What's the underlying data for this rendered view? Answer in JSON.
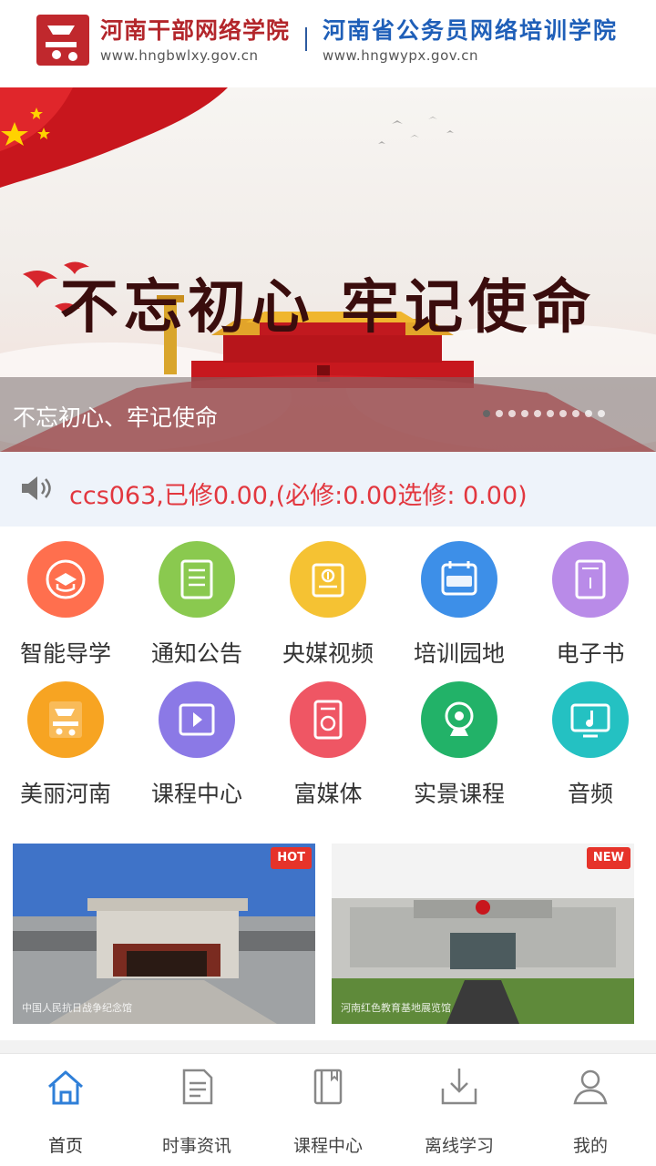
{
  "header": {
    "brand_left_name": "河南干部网络学院",
    "brand_left_url": "www.hngbwlxy.gov.cn",
    "brand_right_name": "河南省公务员网络培训学院",
    "brand_right_url": "www.hngwypx.gov.cn",
    "logo_icon": "red-seal-logo-icon"
  },
  "banner": {
    "title": "不忘初心 牢记使命",
    "caption": "不忘初心、牢记使命",
    "slide_count": 10,
    "active_slide": 1
  },
  "notice": {
    "icon": "speaker-icon",
    "text": "ccs063,已修0.00,(必修:0.00选修: 0.00)",
    "color": "#e2373f"
  },
  "grid": [
    {
      "label": "智能导学",
      "icon": "guide-icon",
      "color": "#ff6f4e"
    },
    {
      "label": "通知公告",
      "icon": "notice-board-icon",
      "color": "#8ac94f"
    },
    {
      "label": "央媒视频",
      "icon": "media-video-icon",
      "color": "#f5c233"
    },
    {
      "label": "培训园地",
      "icon": "class-calendar-icon",
      "color": "#3d8fe8"
    },
    {
      "label": "电子书",
      "icon": "ebook-icon",
      "color": "#b98be8"
    },
    {
      "label": "美丽河南",
      "icon": "henan-seal-icon",
      "color": "#f7a422"
    },
    {
      "label": "课程中心",
      "icon": "video-course-icon",
      "color": "#8b79e6"
    },
    {
      "label": "富媒体",
      "icon": "rich-media-icon",
      "color": "#ef5664"
    },
    {
      "label": "实景课程",
      "icon": "webcam-icon",
      "color": "#22b268"
    },
    {
      "label": "音频",
      "icon": "audio-icon",
      "color": "#24c1c2"
    }
  ],
  "promos": [
    {
      "badge": "HOT",
      "caption": "中国人民抗日战争纪念馆",
      "color": "#e6332a"
    },
    {
      "badge": "NEW",
      "caption": "河南红色教育基地展览馆",
      "color": "#e6332a"
    }
  ],
  "tabbar": [
    {
      "label": "首页",
      "icon": "home-icon",
      "active": true
    },
    {
      "label": "时事资讯",
      "icon": "news-document-icon",
      "active": false
    },
    {
      "label": "课程中心",
      "icon": "book-icon",
      "active": false
    },
    {
      "label": "离线学习",
      "icon": "download-icon",
      "active": false
    },
    {
      "label": "我的",
      "icon": "user-icon",
      "active": false
    }
  ]
}
